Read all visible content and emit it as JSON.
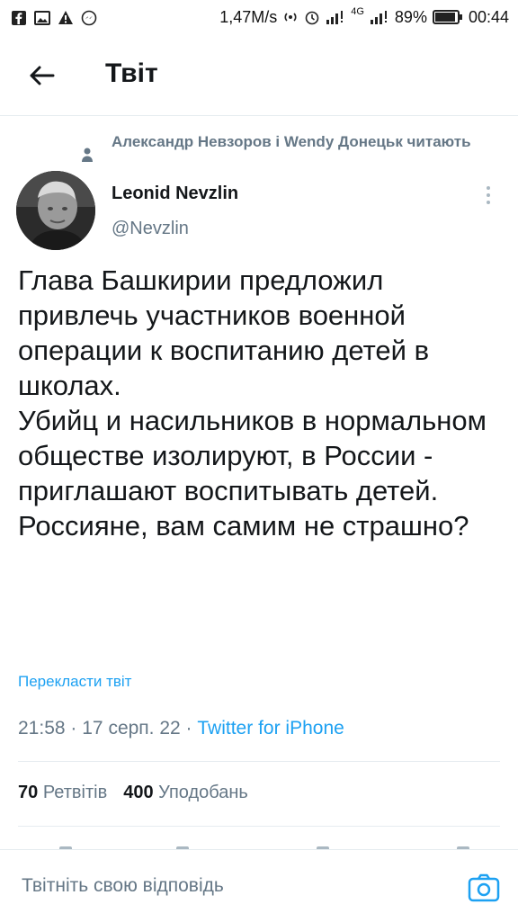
{
  "status_bar": {
    "speed": "1,47M/s",
    "network_label": "4G",
    "battery": "89%",
    "time": "00:44",
    "left_icons": [
      "facebook-icon",
      "gallery-icon",
      "warning-icon",
      "messenger-icon"
    ]
  },
  "header": {
    "title": "Твіт"
  },
  "tweet": {
    "social_context": "Александр Невзоров і Wendy Донецьк читають",
    "author_name": "Leonid Nevzlin",
    "author_handle": "@Nevzlin",
    "text": "Глава Башкирии предложил привлечь участников военной операции к воспитанию детей в школах.\nУбийц и насильников в нормальном обществе изолируют, в России - приглашают воспитывать детей. Россияне, вам самим не страшно?",
    "translate_label": "Перекласти твіт",
    "time": "21:58",
    "date": "17 серп. 22",
    "source": "Twitter for iPhone",
    "separator": "·",
    "retweets_count": "70",
    "retweets_label": "Ретвітів",
    "likes_count": "400",
    "likes_label": "Уподобань"
  },
  "reply": {
    "placeholder": "Твітніть свою відповідь"
  },
  "colors": {
    "accent": "#1da1f2",
    "secondary_text": "#657786",
    "divider": "#e6ecf0"
  }
}
